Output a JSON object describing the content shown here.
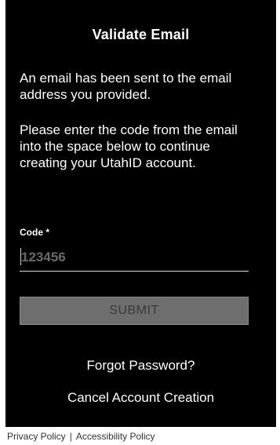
{
  "dialog": {
    "title": "Validate Email",
    "paragraph_1": "An email has been sent to the email address you provided.",
    "paragraph_2": "Please enter the code from the email into the space below to continue creating your UtahID account."
  },
  "code_field": {
    "label": "Code *",
    "value": "",
    "placeholder": "123456"
  },
  "actions": {
    "submit_label": "SUBMIT",
    "forgot_password_label": "Forgot Password?",
    "cancel_label": "Cancel Account Creation"
  },
  "footer": {
    "privacy_label": "Privacy Policy",
    "separator": "|",
    "accessibility_label": "Accessibility Policy"
  },
  "colors": {
    "panel_background": "#000000",
    "text": "#ffffff",
    "submit_button_disabled": "#6e6e6e",
    "page_background": "#ffffff"
  }
}
